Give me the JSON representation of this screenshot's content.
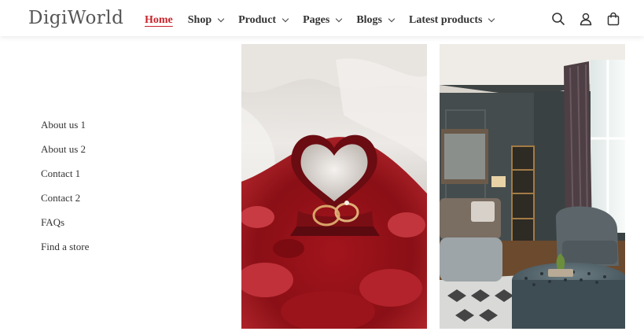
{
  "header": {
    "logo": "DigiWorld",
    "nav": [
      {
        "label": "Home",
        "dropdown": false,
        "active": true
      },
      {
        "label": "Shop",
        "dropdown": true
      },
      {
        "label": "Product",
        "dropdown": true
      },
      {
        "label": "Pages",
        "dropdown": true
      },
      {
        "label": "Blogs",
        "dropdown": true
      },
      {
        "label": "Latest products",
        "dropdown": true
      }
    ],
    "icons": [
      "search-icon",
      "account-icon",
      "cart-icon"
    ],
    "accent_color": "#c8242b"
  },
  "sidebar": {
    "links": [
      "About us 1",
      "About us 2",
      "Contact 1",
      "Contact 2",
      "FAQs",
      "Find a store"
    ]
  },
  "gallery": {
    "images": [
      "ring-box-on-rose-petals",
      "living-room-with-ottoman"
    ]
  }
}
